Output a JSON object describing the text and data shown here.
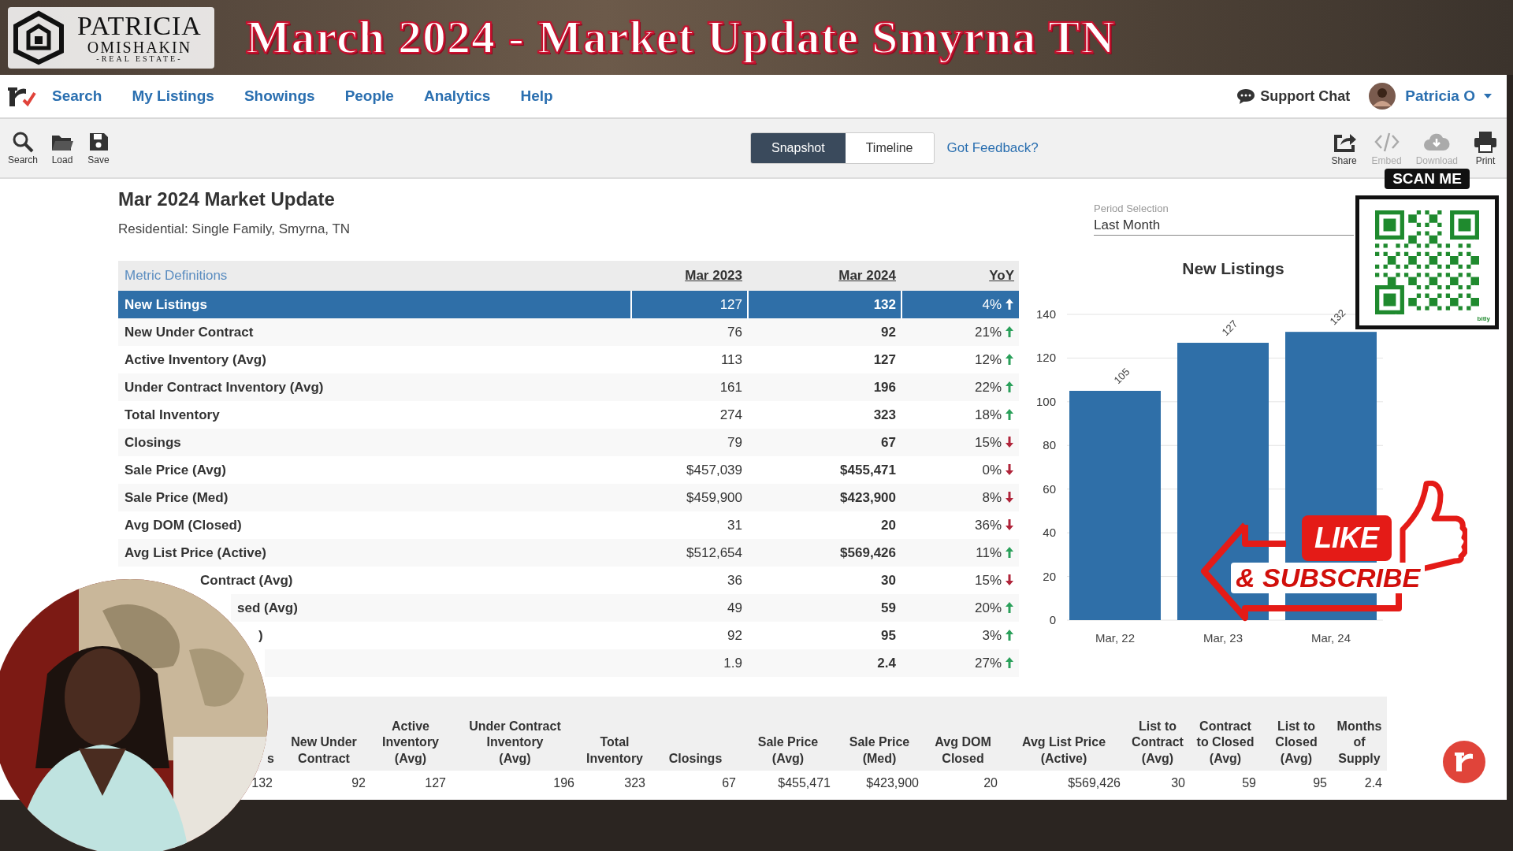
{
  "banner": {
    "logo_name": "PATRICIA",
    "logo_sub": "OMISHAKIN",
    "logo_tag": "-REAL ESTATE-",
    "title": "March 2024 - Market Update Smyrna TN"
  },
  "nav": {
    "items": [
      {
        "label": "Search"
      },
      {
        "label": "My Listings"
      },
      {
        "label": "Showings"
      },
      {
        "label": "People"
      },
      {
        "label": "Analytics"
      },
      {
        "label": "Help"
      }
    ],
    "support": "Support Chat",
    "user": "Patricia O"
  },
  "toolbar": {
    "left": [
      {
        "label": "Search"
      },
      {
        "label": "Load"
      },
      {
        "label": "Save"
      }
    ],
    "views": [
      {
        "label": "Snapshot",
        "selected": true
      },
      {
        "label": "Timeline",
        "selected": false
      }
    ],
    "feedback": "Got Feedback?",
    "right": [
      {
        "label": "Share",
        "disabled": false
      },
      {
        "label": "Embed",
        "disabled": true
      },
      {
        "label": "Download",
        "disabled": true
      },
      {
        "label": "Print",
        "disabled": false
      }
    ]
  },
  "report": {
    "title": "Mar 2024 Market Update",
    "subtitle": "Residential: Single Family, Smyrna, TN"
  },
  "table": {
    "columns": [
      "Metric Definitions",
      "Mar 2023",
      "Mar 2024",
      "YoY"
    ],
    "rows": [
      {
        "label": "New Listings",
        "prev": "127",
        "curr": "132",
        "yoy": "4%",
        "increase": true,
        "selected": true
      },
      {
        "label": "New Under Contract",
        "prev": "76",
        "curr": "92",
        "yoy": "21%",
        "increase": true,
        "selected": false
      },
      {
        "label": "Active Inventory (Avg)",
        "prev": "113",
        "curr": "127",
        "yoy": "12%",
        "increase": true,
        "selected": false
      },
      {
        "label": "Under Contract Inventory (Avg)",
        "prev": "161",
        "curr": "196",
        "yoy": "22%",
        "increase": true,
        "selected": false
      },
      {
        "label": "Total Inventory",
        "prev": "274",
        "curr": "323",
        "yoy": "18%",
        "increase": true,
        "selected": false
      },
      {
        "label": "Closings",
        "prev": "79",
        "curr": "67",
        "yoy": "15%",
        "increase": false,
        "selected": false
      },
      {
        "label": "Sale Price (Avg)",
        "prev": "$457,039",
        "curr": "$455,471",
        "yoy": "0%",
        "increase": false,
        "selected": false
      },
      {
        "label": "Sale Price (Med)",
        "prev": "$459,900",
        "curr": "$423,900",
        "yoy": "8%",
        "increase": false,
        "selected": false
      },
      {
        "label": "Avg DOM (Closed)",
        "prev": "31",
        "curr": "20",
        "yoy": "36%",
        "increase": false,
        "selected": false
      },
      {
        "label": "Avg List Price (Active)",
        "prev": "$512,654",
        "curr": "$569,426",
        "yoy": "11%",
        "increase": true,
        "selected": false
      },
      {
        "label": "Contract (Avg)",
        "prev": "36",
        "curr": "30",
        "yoy": "15%",
        "increase": false,
        "selected": false
      },
      {
        "label": "sed (Avg)",
        "prev": "49",
        "curr": "59",
        "yoy": "20%",
        "increase": true,
        "selected": false
      },
      {
        "label": ")",
        "prev": "92",
        "curr": "95",
        "yoy": "3%",
        "increase": true,
        "selected": false
      },
      {
        "prev": "1.9",
        "curr": "2.4",
        "yoy": "27%",
        "increase": true,
        "selected": false
      }
    ]
  },
  "period": {
    "label": "Period Selection",
    "value": "Last Month"
  },
  "chart": {
    "chart_data": {
      "type": "bar",
      "title": "New Listings",
      "categories": [
        "Mar, 22",
        "Mar, 23",
        "Mar, 24"
      ],
      "values": [
        105,
        127,
        132
      ],
      "ylim": [
        0,
        140
      ],
      "yticks": [
        0,
        20,
        40,
        60,
        80,
        100,
        120,
        140
      ],
      "grid": true,
      "data_labels": true
    }
  },
  "summary": {
    "columns": [
      "s",
      "New Under\nContract",
      "Active\nInventory\n(Avg)",
      "Under Contract\nInventory\n(Avg)",
      "Total\nInventory",
      "Closings",
      "Sale Price\n(Avg)",
      "Sale Price\n(Med)",
      "Avg DOM\nClosed",
      "Avg List Price\n(Active)",
      "List to\nContract\n(Avg)",
      "Contract\nto Closed\n(Avg)",
      "List to\nClosed\n(Avg)",
      "Months of\nSupply"
    ],
    "values": [
      "132",
      "92",
      "127",
      "196",
      "323",
      "67",
      "$455,471",
      "$423,900",
      "20",
      "$569,426",
      "30",
      "59",
      "95",
      "2.4"
    ]
  },
  "overlays": {
    "scan": "SCAN ME",
    "qr_brand": "bitly",
    "like": "LIKE",
    "subscribe": "& SUBSCRIBE"
  }
}
